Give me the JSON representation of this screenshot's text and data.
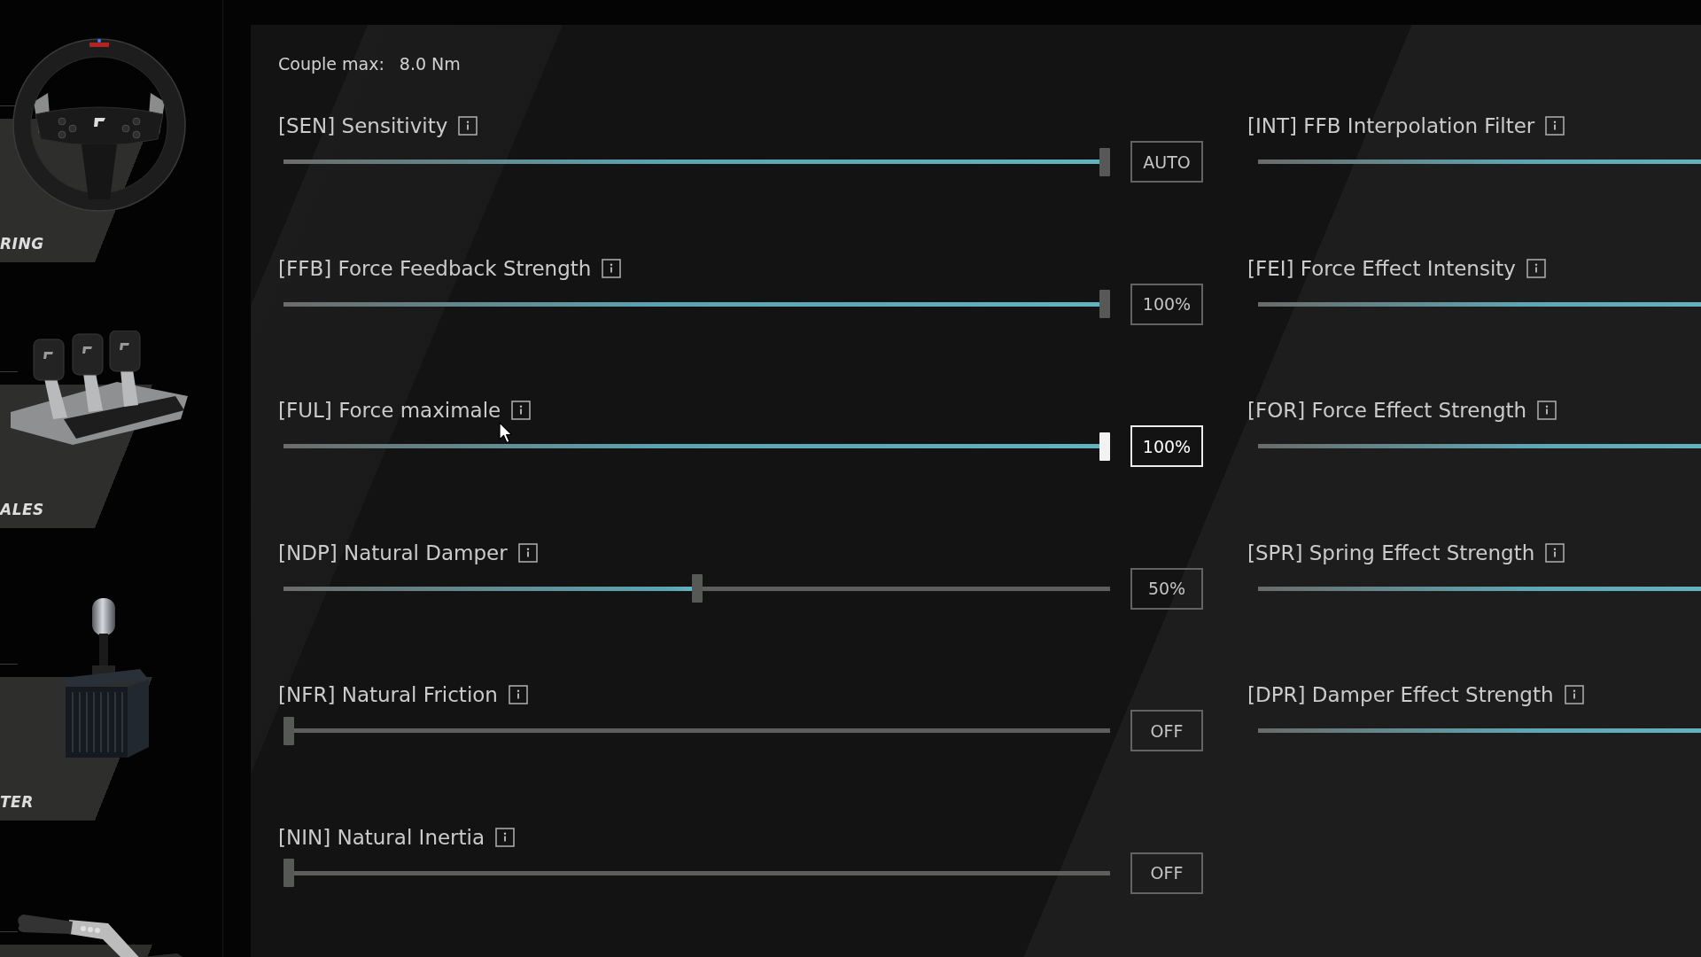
{
  "sidebar": {
    "items": [
      {
        "kind": "wheel",
        "label": "RING"
      },
      {
        "kind": "pedals",
        "label": "ALES"
      },
      {
        "kind": "shifter",
        "label": "TER"
      },
      {
        "kind": "handbrake"
      }
    ]
  },
  "panel": {
    "max_torque": {
      "label": "Couple max:",
      "value": "8.0 Nm"
    },
    "settings_left": [
      {
        "label": "[SEN] Sensitivity",
        "level": 1,
        "value": "AUTO",
        "selected": false
      },
      {
        "label": "[FFB] Force Feedback Strength",
        "level": 1,
        "value": "100%",
        "selected": false
      },
      {
        "label": "[FUL] Force maximale",
        "level": 1,
        "value": "100%",
        "selected": true
      },
      {
        "label": "[NDP] Natural Damper",
        "level": 0.5,
        "value": "50%",
        "selected": false
      },
      {
        "label": "[NFR] Natural Friction",
        "level": 0,
        "value": "OFF",
        "selected": false
      },
      {
        "label": "[NIN] Natural Inertia",
        "level": 0,
        "value": "OFF",
        "selected": false
      }
    ],
    "settings_right": [
      {
        "label": "[INT] FFB Interpolation Filter"
      },
      {
        "label": "[FEI] Force Effect Intensity"
      },
      {
        "label": "[FOR] Force Effect Strength"
      },
      {
        "label": "[SPR] Spring Effect Strength"
      },
      {
        "label": "[DPR] Damper Effect Strength"
      }
    ]
  }
}
